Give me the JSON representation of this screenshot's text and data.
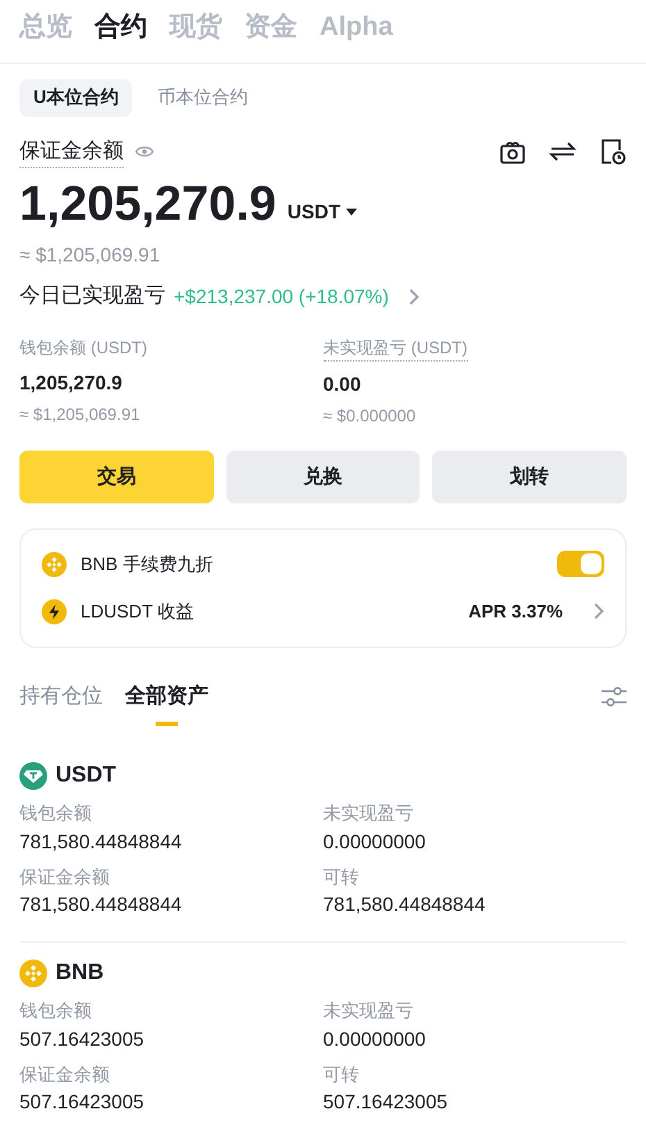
{
  "top_tabs": [
    {
      "label": "总览",
      "selected": false
    },
    {
      "label": "合约",
      "selected": true
    },
    {
      "label": "现货",
      "selected": false
    },
    {
      "label": "资金",
      "selected": false
    },
    {
      "label": "Alpha",
      "selected": false
    }
  ],
  "contract_tabs": [
    {
      "label": "U本位合约",
      "selected": true
    },
    {
      "label": "币本位合约",
      "selected": false
    }
  ],
  "balance": {
    "label": "保证金余额",
    "amount": "1,205,270.9",
    "unit": "USDT",
    "approx": "≈ $1,205,069.91"
  },
  "pnl_today": {
    "label": "今日已实现盈亏",
    "value": "+$213,237.00 (+18.07%)"
  },
  "stats": [
    {
      "label": "钱包余额 (USDT)",
      "underlined": false,
      "value": "1,205,270.9",
      "approx": "≈ $1,205,069.91"
    },
    {
      "label": "未实现盈亏 (USDT)",
      "underlined": true,
      "value": "0.00",
      "approx": "≈ $0.000000"
    }
  ],
  "buttons": [
    {
      "label": "交易",
      "primary": true
    },
    {
      "label": "兑换",
      "primary": false
    },
    {
      "label": "划转",
      "primary": false
    }
  ],
  "options": [
    {
      "kind": "toggle",
      "label": "BNB 手续费九折",
      "on": true
    },
    {
      "kind": "link",
      "label": "LDUSDT 收益",
      "value": "APR 3.37%"
    }
  ],
  "asset_tabs": [
    {
      "label": "持有仓位",
      "selected": false
    },
    {
      "label": "全部资产",
      "selected": true
    }
  ],
  "assets": [
    {
      "kind": "tether",
      "symbol": "USDT",
      "fields": [
        {
          "label": "钱包余额",
          "value": "781,580.44848844"
        },
        {
          "label": "未实现盈亏",
          "value": "0.00000000"
        },
        {
          "label": "保证金余额",
          "value": "781,580.44848844"
        },
        {
          "label": "可转",
          "value": "781,580.44848844"
        }
      ]
    },
    {
      "kind": "bnb",
      "symbol": "BNB",
      "fields": [
        {
          "label": "钱包余额",
          "value": "507.16423005"
        },
        {
          "label": "未实现盈亏",
          "value": "0.00000000"
        },
        {
          "label": "保证金余额",
          "value": "507.16423005"
        },
        {
          "label": "可转",
          "value": "507.16423005"
        }
      ]
    }
  ]
}
